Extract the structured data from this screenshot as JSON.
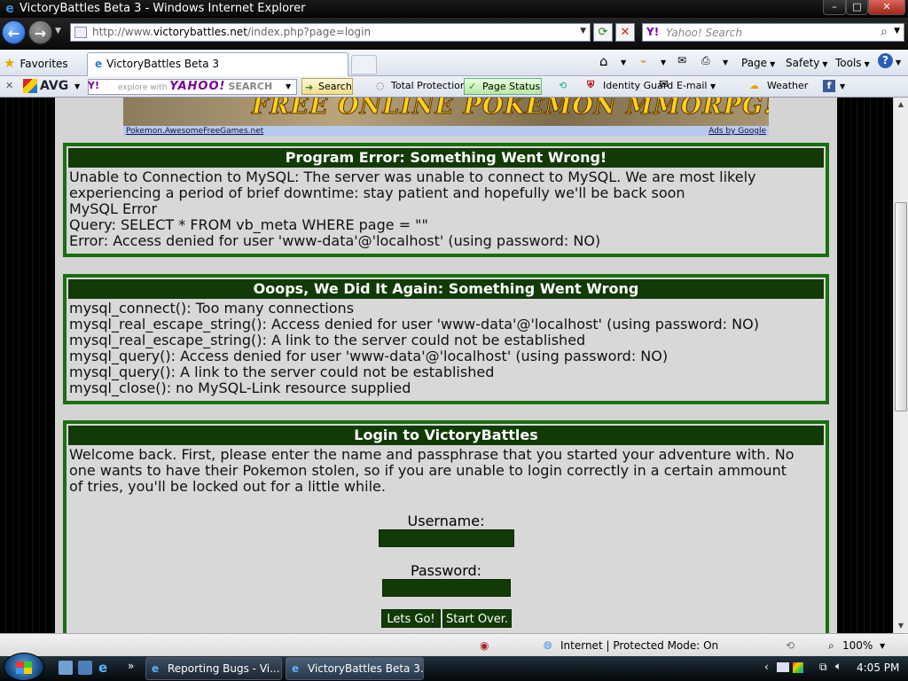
{
  "window": {
    "title": "VictoryBattles Beta 3 - Windows Internet Explorer",
    "controls": [
      "–",
      "□",
      "✕"
    ]
  },
  "address": {
    "url_prefix": "http://www.",
    "url_domain": "victorybattles.net",
    "url_path": "/index.php?page=login"
  },
  "search_box": {
    "placeholder": "Yahoo! Search"
  },
  "command_bar": {
    "favorites": "Favorites",
    "tab_title": "VictoryBattles Beta 3",
    "page": "Page",
    "safety": "Safety",
    "tools": "Tools"
  },
  "toolbar": {
    "avg": "AVG",
    "yahoo_hint": "explore with",
    "yahoo_brand": "YAHOO!",
    "yahoo_search_word": "SEARCH",
    "search_button": "Search",
    "total_protection": "Total Protection",
    "page_status": "Page Status",
    "identity_guard": "Identity Guard",
    "email": "E-mail",
    "weather": "Weather"
  },
  "banner": {
    "text": "FREE ONLINE POKEMON MMORPG!",
    "left_link": "Pokemon.AwesomeFreeGames.net",
    "right_link": "Ads by Google"
  },
  "error_box": {
    "title": "Program Error: Something Went Wrong!",
    "lines": [
      "Unable to Connection to MySQL: The server was unable to connect to MySQL. We are most likely",
      "experiencing a period of brief downtime: stay patient and hopefully we'll be back soon",
      "MySQL Error",
      "Query: SELECT * FROM vb_meta WHERE page = \"\"",
      "Error: Access denied for user 'www-data'@'localhost' (using password: NO)"
    ]
  },
  "oops_box": {
    "title": "Ooops, We Did It Again: Something Went Wrong",
    "lines": [
      "mysql_connect(): Too many connections",
      "mysql_real_escape_string(): Access denied for user 'www-data'@'localhost' (using password: NO)",
      "mysql_real_escape_string(): A link to the server could not be established",
      "mysql_query(): Access denied for user 'www-data'@'localhost' (using password: NO)",
      "mysql_query(): A link to the server could not be established",
      "mysql_close(): no MySQL-Link resource supplied"
    ]
  },
  "login_box": {
    "title": "Login to VictoryBattles",
    "intro_lines": [
      "Welcome back. First, please enter the name and passphrase that you started your adventure with. No",
      "one wants to have their Pokemon stolen, so if you are unable to login correctly in a certain ammount",
      "of tries, you'll be locked out for a little while."
    ],
    "username_label": "Username:",
    "username_value": "",
    "password_label": "Password:",
    "password_value": "",
    "submit_label": "Lets Go!",
    "reset_label": "Start Over."
  },
  "status_bar": {
    "zone": "Internet | Protected Mode: On",
    "zoom": "100%"
  },
  "taskbar": {
    "task1": "Reporting Bugs - Vi...",
    "task2": "VictoryBattles Beta 3...",
    "clock": "4:05 PM"
  },
  "colors": {
    "box_border": "#1a6f0f",
    "box_header": "#123a06",
    "page_bg": "#d4d4d4"
  },
  "icons": [
    "ie-icon",
    "back-icon",
    "forward-icon",
    "refresh-icon",
    "stop-icon",
    "search-icon",
    "star-icon",
    "home-icon",
    "rss-icon",
    "print-icon",
    "help-icon",
    "shield-icon",
    "globe-icon",
    "zoom-icon",
    "windows-start-icon"
  ]
}
